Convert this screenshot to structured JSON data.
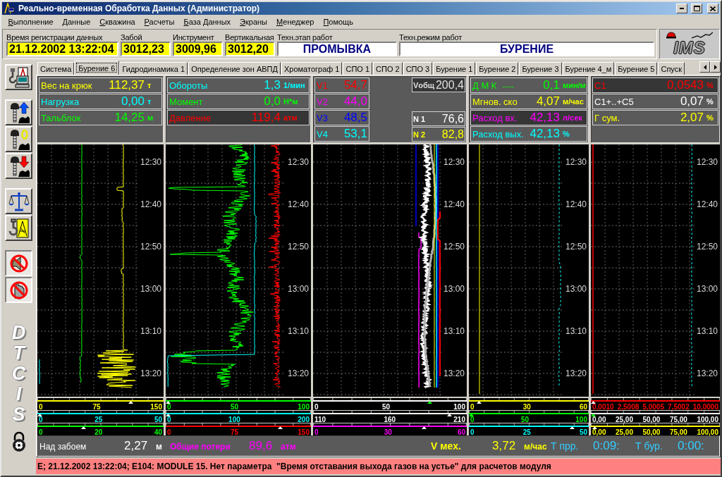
{
  "window": {
    "title": "Реально-временная Обработка Данных (Администратор)"
  },
  "menu": [
    "Выполнение",
    "Данные",
    "Скважина",
    "Расчеты",
    "База Данных",
    "Экраны",
    "Менеджер",
    "Помощь"
  ],
  "header": {
    "fields": [
      {
        "label": "Время регистрации данных",
        "value": "21.12.2002 13:22:04",
        "kind": "reading"
      },
      {
        "label": "Забой",
        "value": "3012,23",
        "kind": "reading"
      },
      {
        "label": "Инструмент",
        "value": "3009,96",
        "kind": "reading"
      },
      {
        "label": "Вертикальная",
        "value": "3012,20",
        "kind": "reading"
      },
      {
        "label": "Техн.этап работ",
        "value": "ПРОМЫВКА",
        "kind": "mode"
      },
      {
        "label": "Техн.режим работ",
        "value": "БУРЕНИЕ",
        "kind": "mode"
      }
    ],
    "logo": "IMS"
  },
  "toolbar": {
    "groups": [
      [
        {
          "pressed": false
        }
      ],
      [
        {
          "pressed": false
        },
        {
          "pressed": false
        },
        {
          "pressed": false
        }
      ],
      [
        {
          "pressed": false
        },
        {
          "pressed": false
        }
      ],
      [
        {
          "pressed": true
        },
        {
          "pressed": true
        }
      ]
    ],
    "logo": "DTCIS"
  },
  "tabs": [
    {
      "label": "Система",
      "selected": false
    },
    {
      "label": "Бурение 6",
      "selected": true
    },
    {
      "label": "Гидродинамика 1",
      "selected": false
    },
    {
      "label": "Определение зон АВПД",
      "selected": false
    },
    {
      "label": "Хроматограф 1",
      "selected": false
    },
    {
      "label": "СПО 1",
      "selected": false
    },
    {
      "label": "СПО 2",
      "selected": false
    },
    {
      "label": "СПО 3",
      "selected": false
    },
    {
      "label": "Бурение 1",
      "selected": false
    },
    {
      "label": "Бурение 2",
      "selected": false
    },
    {
      "label": "Бурение 3",
      "selected": false
    },
    {
      "label": "Бурение 4_м",
      "selected": false
    },
    {
      "label": "Бурение 5",
      "selected": false
    },
    {
      "label": "Спуск",
      "selected": false
    }
  ],
  "tracks": [
    {
      "readouts": [
        {
          "label": "Вес на крюк",
          "value": "112,37",
          "unit": "т",
          "color": "#ffff00",
          "highlighted": false
        },
        {
          "label": "Нагрузка",
          "value": "0,00",
          "unit": "т",
          "color": "#00ffff",
          "highlighted": false
        },
        {
          "label": "Тальблок",
          "value": "14,25",
          "unit": "м",
          "color": "#00ff00",
          "highlighted": false
        }
      ],
      "time_labels": [
        "12:30",
        "12:40",
        "12:50",
        "13:00",
        "13:10",
        "13:20"
      ],
      "scales": [
        {
          "color": "#ffff00",
          "labels": [
            "0",
            "75",
            "150"
          ],
          "marker": {
            "level": 0.75,
            "color": "#ffffff"
          }
        },
        {
          "color": "#00ffff",
          "labels": [
            "0",
            "25",
            "50"
          ],
          "marker": {
            "level": 0,
            "color": "#ffffff"
          }
        },
        {
          "color": "#00ff00",
          "labels": [
            "0",
            "20",
            "40"
          ],
          "marker": {
            "level": 0.36,
            "color": "#ffffff"
          }
        }
      ]
    },
    {
      "readouts": [
        {
          "label": "Обороты",
          "value": "1,3",
          "unit": "1/мин",
          "color": "#00ffff",
          "highlighted": false
        },
        {
          "label": "Момент",
          "value": "0,0",
          "unit": "Н*м",
          "color": "#00ff00",
          "highlighted": false
        },
        {
          "label": "Давление",
          "value": "119,4",
          "unit": "атм",
          "color": "#ff0000",
          "highlighted": true
        }
      ],
      "time_labels": [
        "12:30",
        "12:40",
        "12:50",
        "13:00",
        "13:10",
        "13:20"
      ],
      "scales": [
        {
          "color": "#00ff00",
          "labels": [
            "0",
            "50",
            "100"
          ],
          "marker": {
            "level": 0,
            "color": "#ffffff"
          }
        },
        {
          "color": "#00ffff",
          "labels": [
            "0",
            "100",
            "200"
          ],
          "marker": {
            "level": 0,
            "color": "#ffffff"
          }
        },
        {
          "color": "#ff0000",
          "labels": [
            "0",
            "75",
            "150"
          ],
          "marker": {
            "level": 0.8,
            "color": "#ffffff"
          }
        }
      ]
    },
    {
      "readouts": [
        {
          "label": "V1",
          "value": "54,7",
          "color": "#ff0000",
          "highlighted": false
        },
        {
          "label": "V2",
          "value": "44,0",
          "color": "#ff00ff",
          "highlighted": false
        },
        {
          "label": "V3",
          "value": "48,5",
          "color": "#0000ff",
          "highlighted": false
        },
        {
          "label": "V4",
          "value": "53,1",
          "color": "#00ffff",
          "highlighted": false
        }
      ],
      "side_readouts": [
        {
          "label": "Vобщ",
          "value": "200,4",
          "color": "#e0e0e0",
          "highlighted": true
        },
        {
          "label": "N 1",
          "value": "76,6",
          "color": "#ffffff",
          "highlighted": false
        },
        {
          "label": "N 2",
          "value": "82,8",
          "color": "#ffff00",
          "highlighted": false
        }
      ],
      "time_labels": [
        "12:30",
        "12:40",
        "12:50",
        "13:00",
        "13:10",
        "13:20"
      ],
      "scales": [
        {
          "color": "#ffffff",
          "labels": [
            "0",
            "50",
            "100"
          ],
          "marker": {
            "level": 0.77,
            "color": "#00ff00"
          }
        },
        {
          "color": "#ffffff",
          "labels": [
            "110",
            "160",
            "210"
          ],
          "marker": {
            "level": 0.9,
            "color": "#ffffff"
          }
        },
        {
          "color": "#ff00ff",
          "labels": [
            "0",
            "30",
            "60"
          ],
          "marker": {
            "level": 0.73,
            "color": "#ffffff"
          }
        }
      ]
    },
    {
      "readouts": [
        {
          "label": "Д М К",
          "note": "-----",
          "value": "0,1",
          "unit": "мин/м",
          "color": "#00ff00",
          "highlighted": false
        },
        {
          "label": "Мгнов. ско",
          "value": "4,07",
          "unit": "м/час",
          "color": "#ffff00",
          "highlighted": false
        },
        {
          "label": "Расход вх.",
          "value": "42,13",
          "unit": "л/сек",
          "color": "#ff00ff",
          "highlighted": true
        },
        {
          "label": "Расход вых.",
          "value": "42,13",
          "unit": "%",
          "color": "#00ffff",
          "highlighted": false
        }
      ],
      "time_labels": [
        "12:30",
        "12:40",
        "12:50",
        "13:00",
        "13:10",
        "13:20"
      ],
      "scales": [
        {
          "color": "#ffff00",
          "labels": [
            "0",
            "30",
            "60"
          ],
          "marker": {
            "level": 0.07,
            "color": "#ffffff"
          }
        },
        {
          "color": "#00ff00",
          "labels": [
            "0",
            "50",
            "100"
          ],
          "marker": {
            "level": 0,
            "color": "#00ff00"
          }
        },
        {
          "color": "#00ffff",
          "labels": [
            "0",
            "25",
            "50"
          ],
          "marker": {
            "level": 0.88,
            "color": "#ffffff"
          }
        }
      ]
    },
    {
      "readouts": [
        {
          "label": "C1",
          "value": "0,0543",
          "unit": "%",
          "color": "#ff0000",
          "highlighted": true
        },
        {
          "label": "C1+..+C5",
          "value": "0,07",
          "unit": "%",
          "color": "#ffffff",
          "highlighted": false
        },
        {
          "label": "Г сум.",
          "value": "2,07",
          "unit": "%",
          "color": "#ffff00",
          "highlighted": false
        }
      ],
      "time_labels": [
        "12:30",
        "12:40",
        "12:50",
        "13:00",
        "13:10",
        "13:20"
      ],
      "scales": [
        {
          "color": "#ff0000",
          "labels": [
            "0,0010",
            "2,5008",
            "5,0005",
            "7,5002",
            "10,0000"
          ],
          "marker": {
            "level": 0,
            "color": "#ffffff"
          }
        },
        {
          "color": "#ffffff",
          "labels": [
            "0,00",
            "25,00",
            "50,00",
            "75,00",
            "100,00"
          ],
          "marker": {
            "level": 0,
            "color": "#00ff00"
          }
        },
        {
          "color": "#ffff00",
          "labels": [
            "0,00",
            "25,00",
            "50,00",
            "75,00",
            "100,00"
          ],
          "marker": {
            "level": 0.01,
            "color": "#ffffff"
          }
        }
      ]
    }
  ],
  "info_bar": [
    {
      "label": "Над забоем",
      "value": "2,27",
      "unit": "м",
      "color": "#ffffff"
    },
    {
      "label": "Общие потери",
      "value": "89,6",
      "unit": "атм",
      "color": "#ff00ff"
    },
    {
      "label": "V мех.",
      "value": "3,72",
      "unit": "м/час",
      "color": "#ffff00"
    },
    {
      "label": "Т прр.",
      "value": "0:09:",
      "color": "#33ccff"
    },
    {
      "label": "Т бур.",
      "value": "0:00:",
      "color": "#33ccff"
    }
  ],
  "status_bar": "E; 21.12.2002 13:22:04; E104: MODULE 15. Нет параметра  \"Время отставания выхода газов на устье\" для расчетов модуля"
}
